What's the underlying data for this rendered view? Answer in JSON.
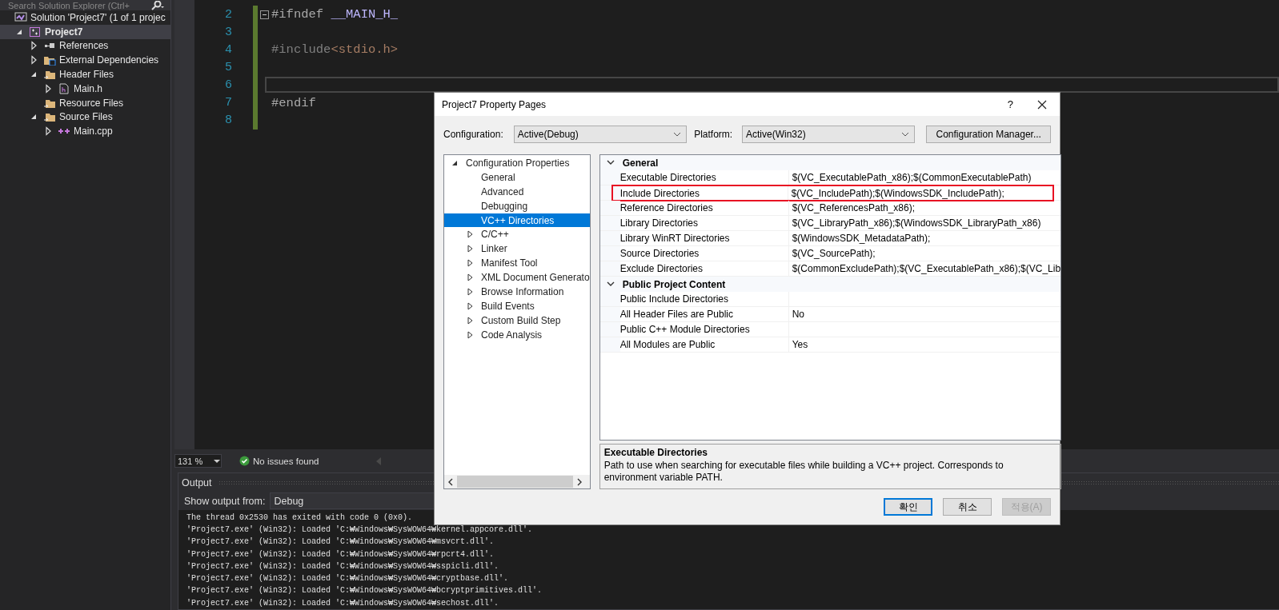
{
  "solution_explorer": {
    "search": {
      "placeholder": "Search Solution Explorer (Ctrl+"
    },
    "tree": [
      {
        "label": "Solution 'Project7' (1 of 1 projec",
        "kind": "solution",
        "selected": false
      },
      {
        "label": "Project7",
        "kind": "project",
        "selected": true,
        "expanded": true,
        "children": [
          {
            "label": "References",
            "kind": "references",
            "selected": false,
            "expanded": false
          },
          {
            "label": "External Dependencies",
            "kind": "dependencies",
            "selected": false,
            "expanded": false
          },
          {
            "label": "Header Files",
            "kind": "folder",
            "selected": false,
            "expanded": true,
            "children": [
              {
                "label": "Main.h",
                "kind": "header",
                "selected": false,
                "expanded": false
              }
            ]
          },
          {
            "label": "Resource Files",
            "kind": "folder",
            "selected": false
          },
          {
            "label": "Source Files",
            "kind": "folder",
            "selected": false,
            "expanded": true,
            "children": [
              {
                "label": "Main.cpp",
                "kind": "source",
                "selected": false,
                "expanded": false
              }
            ]
          }
        ]
      }
    ]
  },
  "editor": {
    "lines": [
      {
        "number": "2",
        "fold": true,
        "current": false,
        "tokens": [
          {
            "text": "#ifndef ",
            "kind": "directive"
          },
          {
            "text": "__MAIN_H_",
            "kind": "macro"
          }
        ]
      },
      {
        "number": "3",
        "fold": false,
        "current": false
      },
      {
        "number": "4",
        "fold": false,
        "current": false,
        "tokens": [
          {
            "text": "#include",
            "kind": "inactive"
          },
          {
            "text": "<stdio.h>",
            "kind": "string"
          }
        ]
      },
      {
        "number": "5",
        "fold": false,
        "current": false
      },
      {
        "number": "6",
        "fold": false,
        "current": true
      },
      {
        "number": "7",
        "fold": false,
        "current": false,
        "tokens": [
          {
            "text": "#endif",
            "kind": "directive"
          }
        ]
      },
      {
        "number": "8",
        "fold": false,
        "current": false
      }
    ]
  },
  "status_bar": {
    "zoom": "131 %",
    "issues": "No issues found"
  },
  "output": {
    "title": "Output",
    "source_label": "Show output from:",
    "source": "Debug",
    "lines": [
      "The thread 0x2530 has exited with code 0 (0x0).",
      "'Project7.exe' (Win32): Loaded 'C:₩Windows₩SysWOW64₩kernel.appcore.dll'.",
      "'Project7.exe' (Win32): Loaded 'C:₩Windows₩SysWOW64₩msvcrt.dll'.",
      "'Project7.exe' (Win32): Loaded 'C:₩Windows₩SysWOW64₩rpcrt4.dll'.",
      "'Project7.exe' (Win32): Loaded 'C:₩Windows₩SysWOW64₩sspicli.dll'.",
      "'Project7.exe' (Win32): Loaded 'C:₩Windows₩SysWOW64₩cryptbase.dll'.",
      "'Project7.exe' (Win32): Loaded 'C:₩Windows₩SysWOW64₩bcryptprimitives.dll'.",
      "'Project7.exe' (Win32): Loaded 'C:₩Windows₩SysWOW64₩sechost.dll'."
    ]
  },
  "dialog": {
    "title": "Project7 Property Pages",
    "help": "?",
    "configuration": {
      "label": "Configuration:",
      "value": "Active(Debug)"
    },
    "platform": {
      "label": "Platform:",
      "value": "Active(Win32)"
    },
    "manager_button": "Configuration Manager...",
    "tree": [
      {
        "label": "Configuration Properties",
        "selected": false,
        "expanded": true,
        "children": [
          {
            "label": "General",
            "selected": false
          },
          {
            "label": "Advanced",
            "selected": false
          },
          {
            "label": "Debugging",
            "selected": false
          },
          {
            "label": "VC++ Directories",
            "selected": true
          },
          {
            "label": "C/C++",
            "selected": false,
            "expanded": false
          },
          {
            "label": "Linker",
            "selected": false,
            "expanded": false
          },
          {
            "label": "Manifest Tool",
            "selected": false,
            "expanded": false
          },
          {
            "label": "XML Document Generato",
            "selected": false,
            "expanded": false
          },
          {
            "label": "Browse Information",
            "selected": false,
            "expanded": false
          },
          {
            "label": "Build Events",
            "selected": false,
            "expanded": false
          },
          {
            "label": "Custom Build Step",
            "selected": false,
            "expanded": false
          },
          {
            "label": "Code Analysis",
            "selected": false,
            "expanded": false
          }
        ]
      }
    ],
    "groups": [
      {
        "title": "General",
        "expanded": true,
        "rows": [
          {
            "name": "Executable Directories",
            "value": "$(VC_ExecutablePath_x86);$(CommonExecutablePath)",
            "highlighted": false
          },
          {
            "name": "Include Directories",
            "value": "$(VC_IncludePath);$(WindowsSDK_IncludePath);",
            "highlighted": true
          },
          {
            "name": "Reference Directories",
            "value": "$(VC_ReferencesPath_x86);",
            "highlighted": false
          },
          {
            "name": "Library Directories",
            "value": "$(VC_LibraryPath_x86);$(WindowsSDK_LibraryPath_x86)",
            "highlighted": false
          },
          {
            "name": "Library WinRT Directories",
            "value": "$(WindowsSDK_MetadataPath);",
            "highlighted": false
          },
          {
            "name": "Source Directories",
            "value": "$(VC_SourcePath);",
            "highlighted": false
          },
          {
            "name": "Exclude Directories",
            "value": "$(CommonExcludePath);$(VC_ExecutablePath_x86);$(VC_Lib",
            "highlighted": false
          }
        ]
      },
      {
        "title": "Public Project Content",
        "expanded": true,
        "rows": [
          {
            "name": "Public Include Directories",
            "highlighted": false
          },
          {
            "name": "All Header Files are Public",
            "value": "No",
            "highlighted": false
          },
          {
            "name": "Public C++ Module Directories",
            "highlighted": false
          },
          {
            "name": "All Modules are Public",
            "value": "Yes",
            "highlighted": false
          }
        ]
      }
    ],
    "description": {
      "title": "Executable Directories",
      "text": "Path to use when searching for executable files while building a VC++ project.  Corresponds to environment variable PATH."
    },
    "buttons": [
      {
        "label": "확인",
        "default": true,
        "disabled": false
      },
      {
        "label": "취소",
        "default": false,
        "disabled": false
      },
      {
        "label": "적용(A)",
        "default": false,
        "disabled": true
      }
    ]
  }
}
